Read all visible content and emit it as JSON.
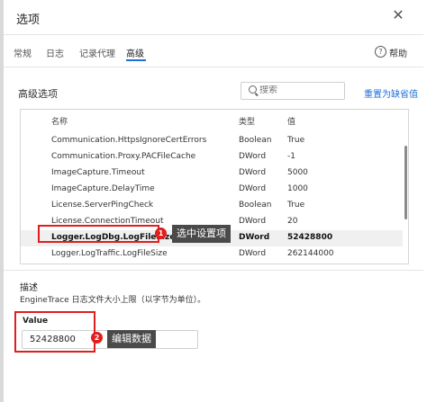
{
  "dialog": {
    "title": "选项",
    "close_glyph": "✕",
    "tabs": [
      {
        "label": "常规",
        "active": false
      },
      {
        "label": "日志",
        "active": false
      },
      {
        "label": "记录代理",
        "active": false
      },
      {
        "label": "高级",
        "active": true
      }
    ],
    "help_glyph": "?",
    "help_label": "帮助"
  },
  "advanced": {
    "section_title": "高级选项",
    "search_placeholder": "搜索",
    "reset_label": "重置为缺省值",
    "columns": {
      "name": "名称",
      "type": "类型",
      "value": "值"
    },
    "rows": [
      {
        "name": "Communication.HttpsIgnoreCertErrors",
        "type": "Boolean",
        "value": "True"
      },
      {
        "name": "Communication.Proxy.PACFileCache",
        "type": "DWord",
        "value": "-1"
      },
      {
        "name": "ImageCapture.Timeout",
        "type": "DWord",
        "value": "5000"
      },
      {
        "name": "ImageCapture.DelayTime",
        "type": "DWord",
        "value": "1000"
      },
      {
        "name": "License.ServerPingCheck",
        "type": "Boolean",
        "value": "True"
      },
      {
        "name": "License.ConnectionTimeout",
        "type": "DWord",
        "value": "20"
      },
      {
        "name": "Logger.LogDbg.LogFileSize",
        "type": "DWord",
        "value": "52428800"
      },
      {
        "name": "Logger.LogTraffic.LogFileSize",
        "type": "DWord",
        "value": "262144000"
      }
    ],
    "selected_row": 6
  },
  "annotations": {
    "badge1": "1",
    "tip1": "选中设置项",
    "badge2": "2",
    "tip2": "编辑数据",
    "color": "#e11d1d"
  },
  "description": {
    "title": "描述",
    "text": "EngineTrace 日志文件大小上限（以字节为单位）。"
  },
  "value_field": {
    "label": "Value",
    "value": "52428800"
  }
}
